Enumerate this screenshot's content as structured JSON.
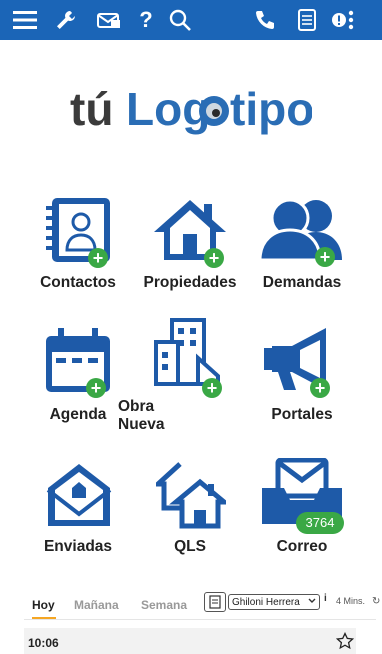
{
  "logo_text": "tú Logotipo",
  "colors": {
    "accent": "#1b65b7",
    "plus": "#3aa845",
    "tab_underline": "#f5a623"
  },
  "tiles": [
    {
      "label": "Contactos",
      "icon": "contact-book-icon"
    },
    {
      "label": "Propiedades",
      "icon": "house-icon"
    },
    {
      "label": "Demandas",
      "icon": "people-icon"
    },
    {
      "label": "Agenda",
      "icon": "calendar-icon"
    },
    {
      "label": "Obra Nueva",
      "icon": "building-icon"
    },
    {
      "label": "Portales",
      "icon": "megaphone-icon"
    },
    {
      "label": "Enviadas",
      "icon": "envelope-house-icon"
    },
    {
      "label": "QLS",
      "icon": "houses-icon"
    },
    {
      "label": "Correo",
      "icon": "inbox-icon",
      "badge": "3764"
    }
  ],
  "tabs": [
    {
      "label": "Hoy",
      "active": true
    },
    {
      "label": "Mañana"
    },
    {
      "label": "Semana"
    }
  ],
  "filter": {
    "selected": "Ghiloni Herrera",
    "info": "i",
    "mins": "4 Mins."
  },
  "event": {
    "time": "10:06"
  }
}
